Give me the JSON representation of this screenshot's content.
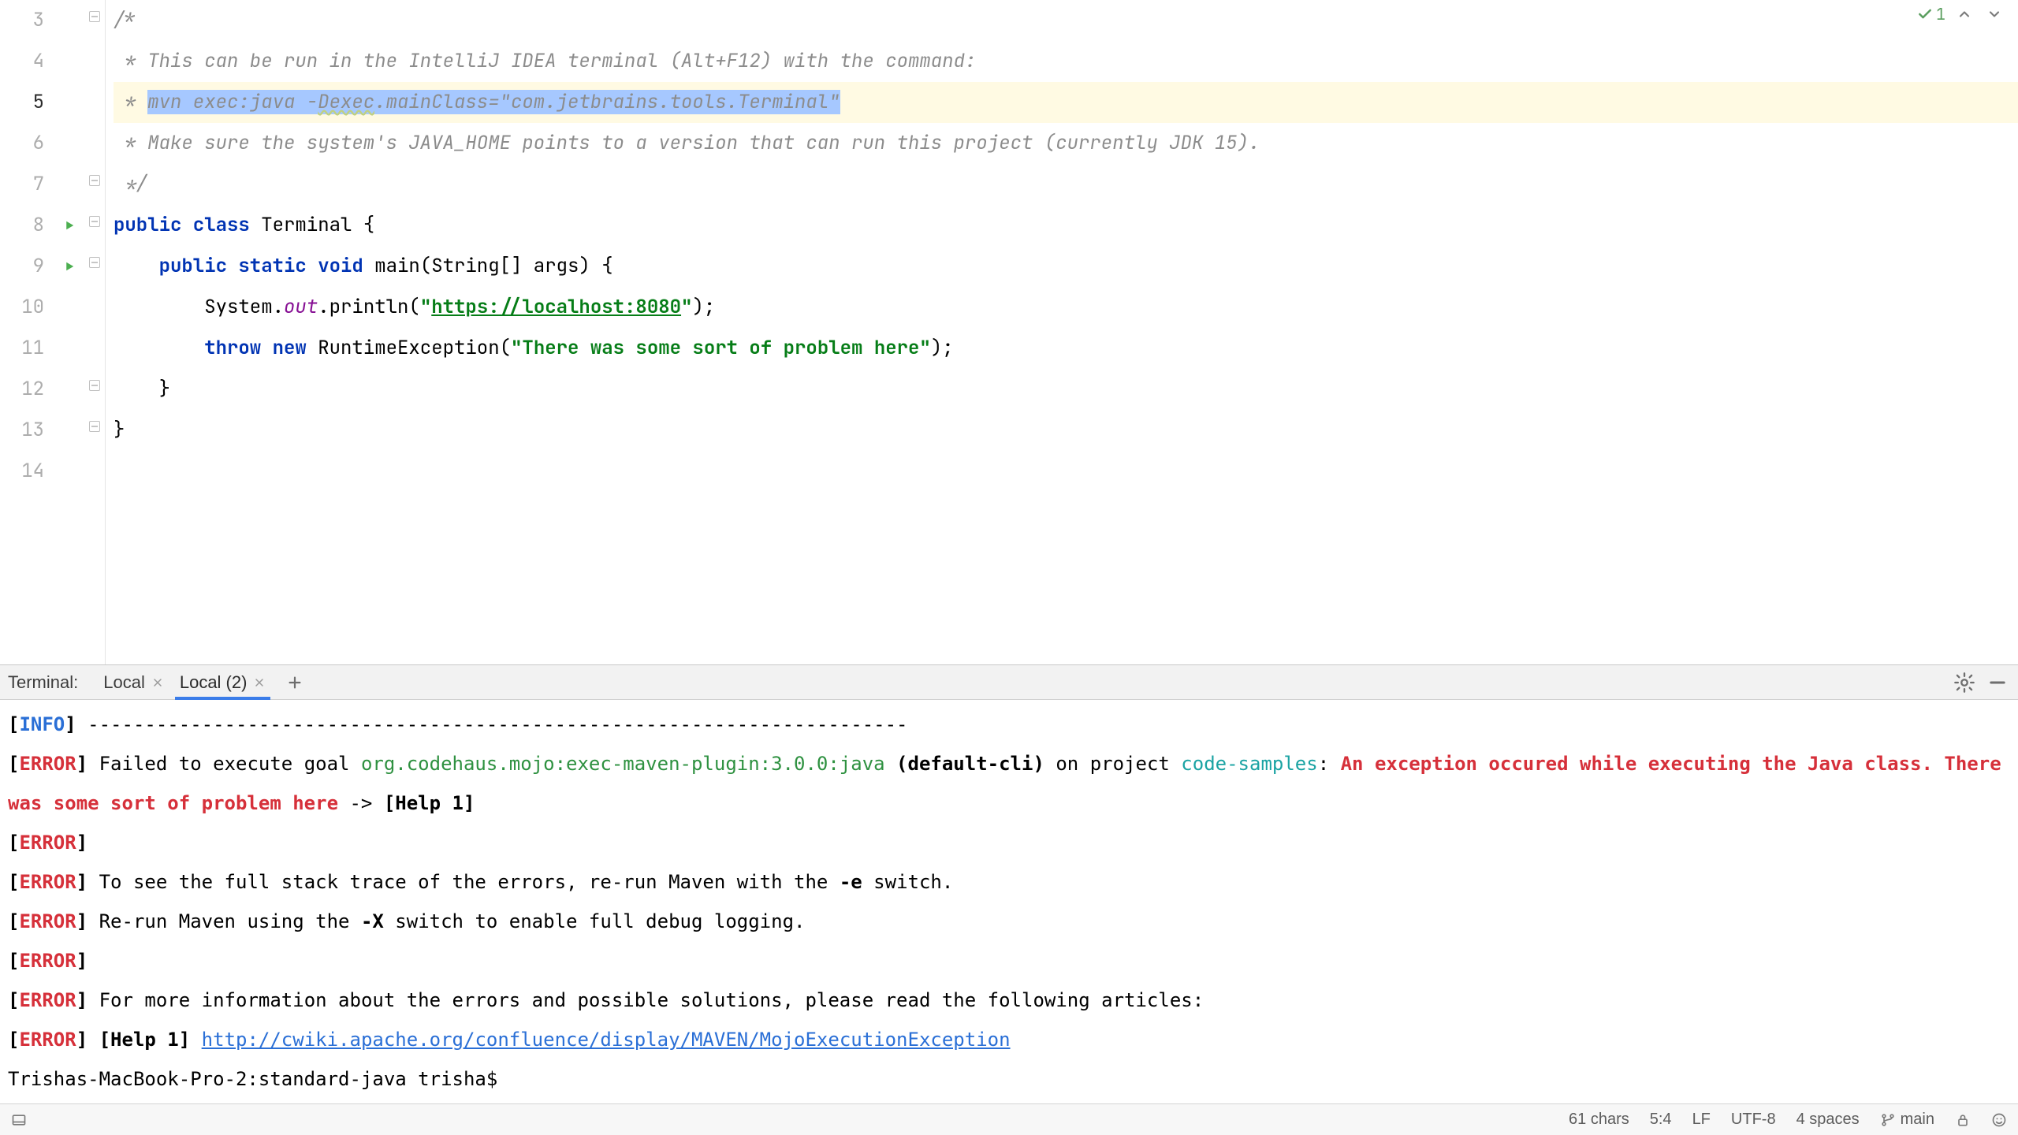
{
  "editor": {
    "lines": [
      {
        "n": 3,
        "kind": "comment",
        "text": "/*"
      },
      {
        "n": 4,
        "kind": "comment",
        "text": " * This can be run in the IntelliJ IDEA terminal (Alt+F12) with the command:"
      },
      {
        "n": 5,
        "kind": "comment-sel",
        "prefix": " * ",
        "sel": "mvn exec:java -",
        "dexec": "Dexec",
        "sel2": ".mainClass=\"com.jetbrains.tools.Terminal\"",
        "current": true
      },
      {
        "n": 6,
        "kind": "comment",
        "text": " * Make sure the system's JAVA_HOME points to a version that can run this project (currently JDK 15)."
      },
      {
        "n": 7,
        "kind": "comment",
        "text": " */"
      },
      {
        "n": 8,
        "kind": "class-decl",
        "kw1": "public class",
        "ident": " Terminal ",
        "brace": "{",
        "run": true
      },
      {
        "n": 9,
        "kind": "method-decl",
        "indent": "    ",
        "kw1": "public static void",
        "ident": " main(String[] args) ",
        "brace": "{",
        "run": true
      },
      {
        "n": 10,
        "kind": "println",
        "indent": "        ",
        "pre": "System.",
        "field": "out",
        "mid": ".println(",
        "q1": "\"",
        "url": "https://localhost:8080",
        "q2": "\"",
        "post": ");"
      },
      {
        "n": 11,
        "kind": "throw",
        "indent": "        ",
        "kw1": "throw new",
        "ident": " RuntimeException(",
        "str": "\"There was some sort of problem here\"",
        "post": ");"
      },
      {
        "n": 12,
        "kind": "plain",
        "text": "    }"
      },
      {
        "n": 13,
        "kind": "plain",
        "text": "}"
      },
      {
        "n": 14,
        "kind": "plain",
        "text": ""
      }
    ],
    "inspection_count": "1"
  },
  "terminal": {
    "title": "Terminal:",
    "tabs": [
      {
        "label": "Local",
        "active": false
      },
      {
        "label": "Local (2)",
        "active": true
      }
    ],
    "output": {
      "info_label": "[INFO]",
      "error_label": "[ERROR]",
      "dashes": " ------------------------------------------------------------------------",
      "l1_a": " Failed to execute goal ",
      "l1_goal": "org.codehaus.mojo:exec-maven-plugin:3.0.0:java",
      "l1_b": " (default-cli)",
      "l1_c": " on project ",
      "l1_proj": "code-samples",
      "l1_d": ": ",
      "l1_ex": "An exception occured while executing the Java class. There was some sort of problem here",
      "l1_e": " -> ",
      "l1_help": "[Help 1]",
      "l3": " To see the full stack trace of the errors, re-run Maven with the ",
      "l3_sw": "-e",
      "l3_b": " switch.",
      "l4": " Re-run Maven using the ",
      "l4_sw": "-X",
      "l4_b": " switch to enable full debug logging.",
      "l6": " For more information about the errors and possible solutions, please read the following articles:",
      "l7_a": " ",
      "l7_help": "[Help 1]",
      "l7_b": " ",
      "l7_link": "http://cwiki.apache.org/confluence/display/MAVEN/MojoExecutionException",
      "prompt": "Trishas-MacBook-Pro-2:standard-java trisha$ "
    }
  },
  "status": {
    "chars": "61 chars",
    "pos": "5:4",
    "sep": "LF",
    "enc": "UTF-8",
    "indent": "4 spaces",
    "branch": "main"
  }
}
